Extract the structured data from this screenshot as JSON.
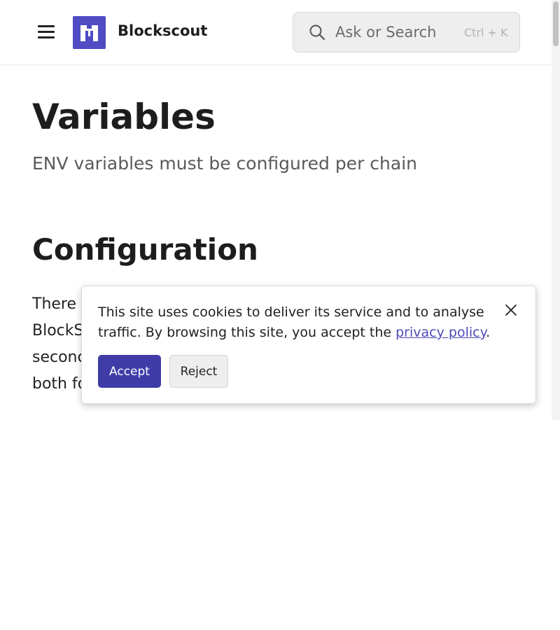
{
  "header": {
    "brand": "Blockscout",
    "menu_icon": "hamburger-menu-icon",
    "logo_icon": "blockscout-logo-icon",
    "search": {
      "placeholder": "Ask or Search",
      "shortcut": "Ctrl + K",
      "icon": "search-icon"
    }
  },
  "main": {
    "title": "Variables",
    "subtitle": "ENV variables must be configured per chain",
    "section_heading": "Configuration",
    "body_visible_lines": [
      "There",
      "BlockSc",
      "seconc",
      "both fo"
    ]
  },
  "cookie_banner": {
    "text_before": "This site uses cookies to deliver its service and to analyse traffic. By browsing this site, you accept the ",
    "link_text": "privacy policy",
    "text_after": ".",
    "accept_label": "Accept",
    "reject_label": "Reject",
    "close_icon": "close-icon"
  },
  "colors": {
    "brand_accent": "#4f4cc4",
    "accept_button": "#3f3ca8",
    "link": "#4e4ab7",
    "search_bg": "#eeeeee"
  }
}
